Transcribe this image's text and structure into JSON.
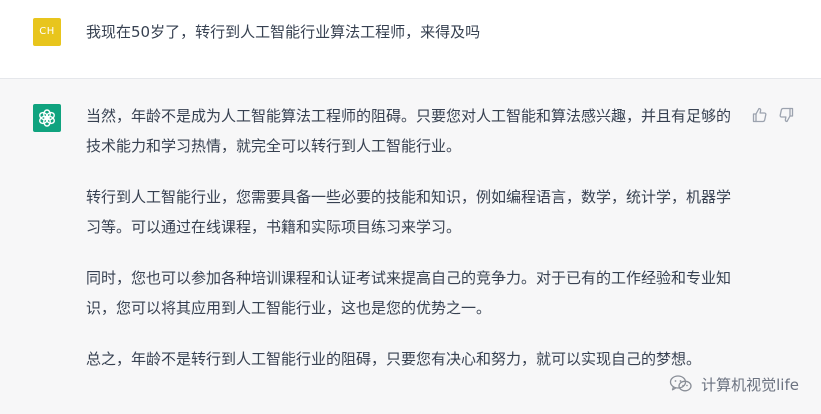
{
  "user": {
    "avatar_initials": "CH",
    "avatar_color": "#e8c51d",
    "message": "我现在50岁了，转行到人工智能行业算法工程师，来得及吗"
  },
  "assistant": {
    "avatar_icon": "openai-logo-icon",
    "avatar_color": "#10a37f",
    "paragraphs": [
      "当然，年龄不是成为人工智能算法工程师的阻碍。只要您对人工智能和算法感兴趣，并且有足够的技术能力和学习热情，就完全可以转行到人工智能行业。",
      "转行到人工智能行业，您需要具备一些必要的技能和知识，例如编程语言，数学，统计学，机器学习等。可以通过在线课程，书籍和实际项目练习来学习。",
      "同时，您也可以参加各种培训课程和认证考试来提高自己的竞争力。对于已有的工作经验和专业知识，您可以将其应用到人工智能行业，这也是您的优势之一。",
      "总之，年龄不是转行到人工智能行业的阻碍，只要您有决心和努力，就可以实现自己的梦想。"
    ],
    "feedback_icons": [
      "thumbs-up-icon",
      "thumbs-down-icon"
    ]
  },
  "watermark": {
    "icon": "wechat-icon",
    "text": "计算机视觉life"
  },
  "colors": {
    "assistant_background": "#f7f7f8",
    "user_background": "#ffffff",
    "text": "#374151"
  }
}
